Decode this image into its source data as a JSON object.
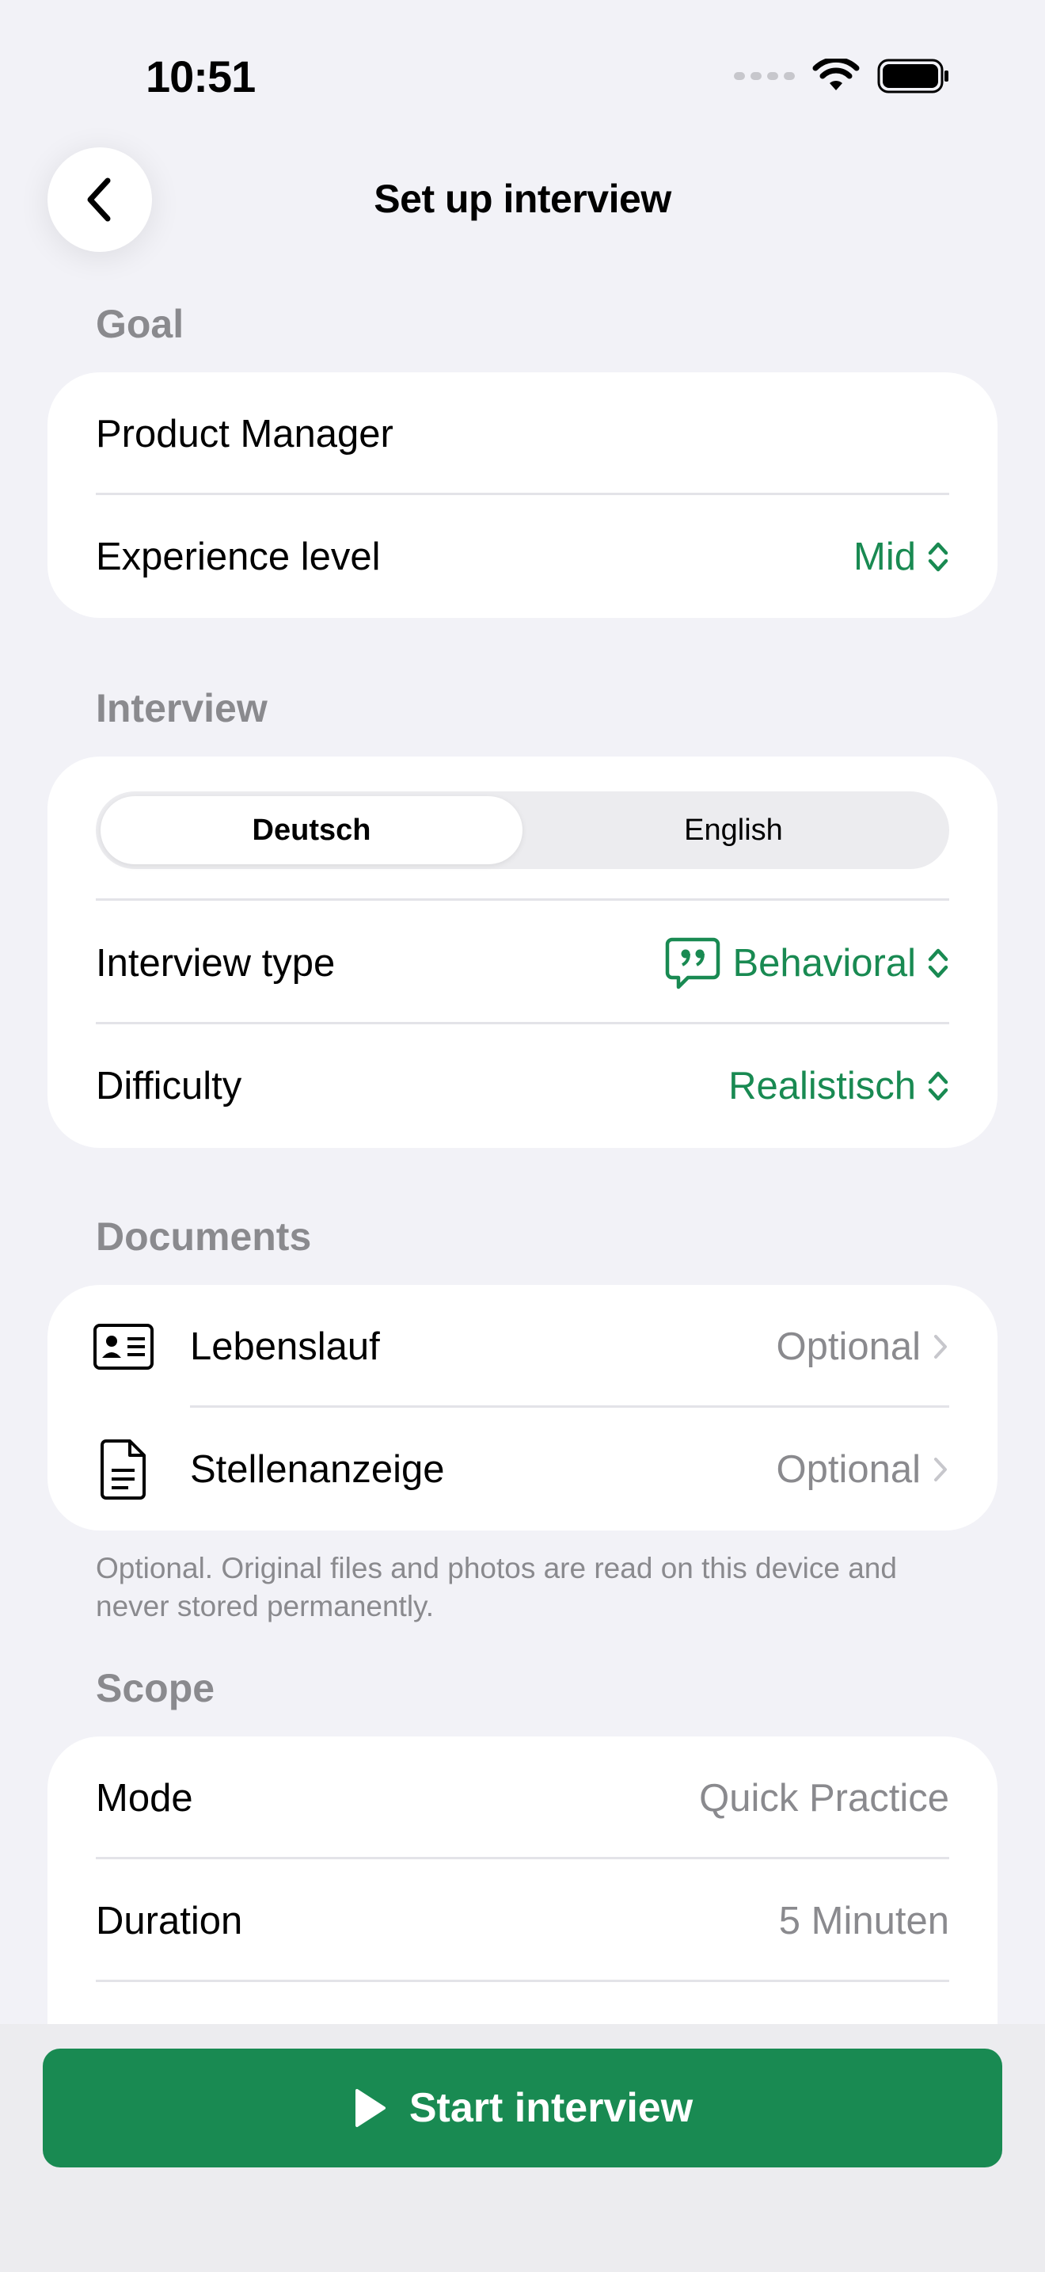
{
  "status_bar": {
    "time": "10:51"
  },
  "nav": {
    "title": "Set up interview"
  },
  "colors": {
    "accent": "#198a52",
    "background": "#f2f2f7",
    "secondary_text": "#8a8a8e"
  },
  "goal": {
    "header": "Goal",
    "role": "Product Manager",
    "experience_label": "Experience level",
    "experience_value": "Mid"
  },
  "interview": {
    "header": "Interview",
    "languages": [
      "Deutsch",
      "English"
    ],
    "selected_language": "Deutsch",
    "type_label": "Interview type",
    "type_value": "Behavioral",
    "type_icon": "quote-bubble-icon",
    "difficulty_label": "Difficulty",
    "difficulty_value": "Realistisch"
  },
  "documents": {
    "header": "Documents",
    "items": [
      {
        "label": "Lebenslauf",
        "status": "Optional",
        "icon": "id-card-icon"
      },
      {
        "label": "Stellenanzeige",
        "status": "Optional",
        "icon": "document-icon"
      }
    ],
    "footnote": "Optional. Original files and photos are read on this device and never stored permanently."
  },
  "scope": {
    "header": "Scope",
    "mode_label": "Mode",
    "mode_value": "Quick Practice",
    "duration_label": "Duration",
    "duration_value": "5 Minuten"
  },
  "actions": {
    "start_label": "Start interview"
  }
}
